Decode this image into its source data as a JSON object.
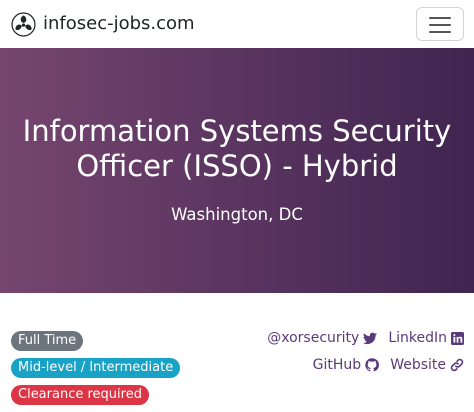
{
  "navbar": {
    "brand_text": "infosec-jobs.com",
    "brand_icon": "biohazard-icon",
    "menu_icon": "hamburger-menu-icon"
  },
  "hero": {
    "title_line1": "Information Systems Security",
    "title_line2": "Officer (ISSO) - Hybrid",
    "location": "Washington, DC"
  },
  "badges": [
    {
      "label": "Full Time",
      "color": "#6c757d"
    },
    {
      "label": "Mid-level / Intermediate",
      "color": "#18a2c5"
    },
    {
      "label": "Clearance required",
      "color": "#dc3545"
    }
  ],
  "links": {
    "twitter": {
      "label": "@xorsecurity",
      "icon": "twitter-icon"
    },
    "linkedin": {
      "label": "LinkedIn",
      "icon": "linkedin-icon"
    },
    "github": {
      "label": "GitHub",
      "icon": "github-icon"
    },
    "website": {
      "label": "Website",
      "icon": "link-icon"
    }
  },
  "colors": {
    "accent": "#5a3a7a",
    "hero_gradient_start": "#76466f",
    "hero_gradient_end": "#3f2550"
  }
}
